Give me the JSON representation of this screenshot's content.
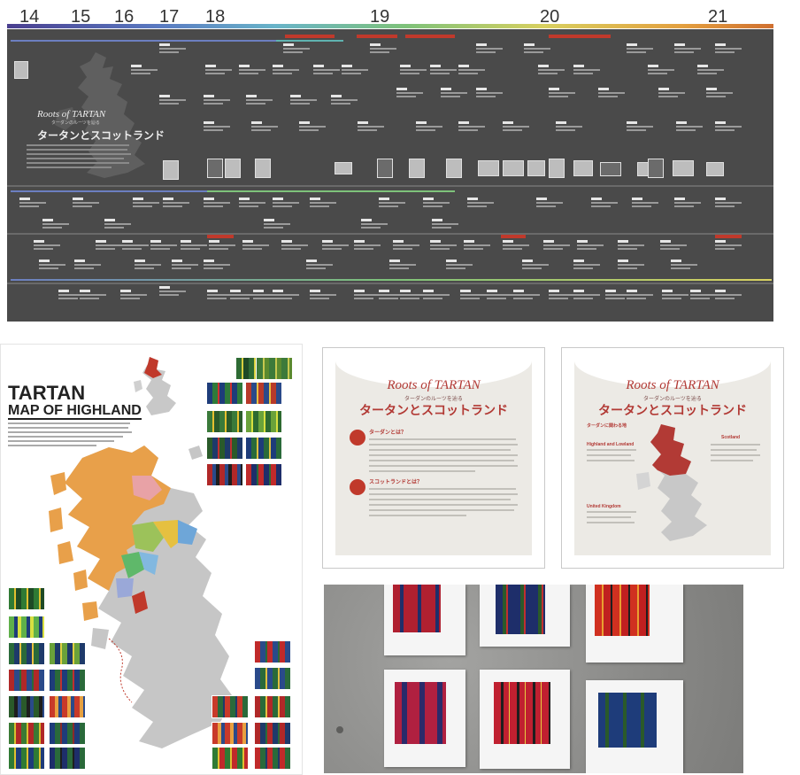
{
  "timeline": {
    "centuries": [
      "14",
      "15",
      "16",
      "17",
      "18",
      "19",
      "20",
      "21"
    ],
    "heading": {
      "latin": "Roots of TARTAN",
      "subtitle": "ターダンのルーツを辿る",
      "main": "タータンとスコットランド"
    }
  },
  "map_poster": {
    "title": "TARTAN",
    "subtitle": "MAP OF HIGHLAND"
  },
  "panel_one": {
    "latin": "Roots of TARTAN",
    "subtitle": "ターダンのルーツを辿る",
    "main": "タータンとスコットランド",
    "q1": "ターダンとは？",
    "q2": "スコットランドとは？"
  },
  "panel_two": {
    "latin": "Roots of TARTAN",
    "subtitle": "ターダンのルーツを辿る",
    "main": "タータンとスコットランド",
    "section": "ターダンに関わる地",
    "region_left": "Highland and Lowland",
    "region_right": "Scotland",
    "region_bottom": "United Kingdom"
  },
  "colors": {
    "accent_red": "#b23a35",
    "timeline_bg": "#4a4a4a",
    "map_orange": "#e8a04a",
    "map_gray": "#c6c6c6"
  }
}
